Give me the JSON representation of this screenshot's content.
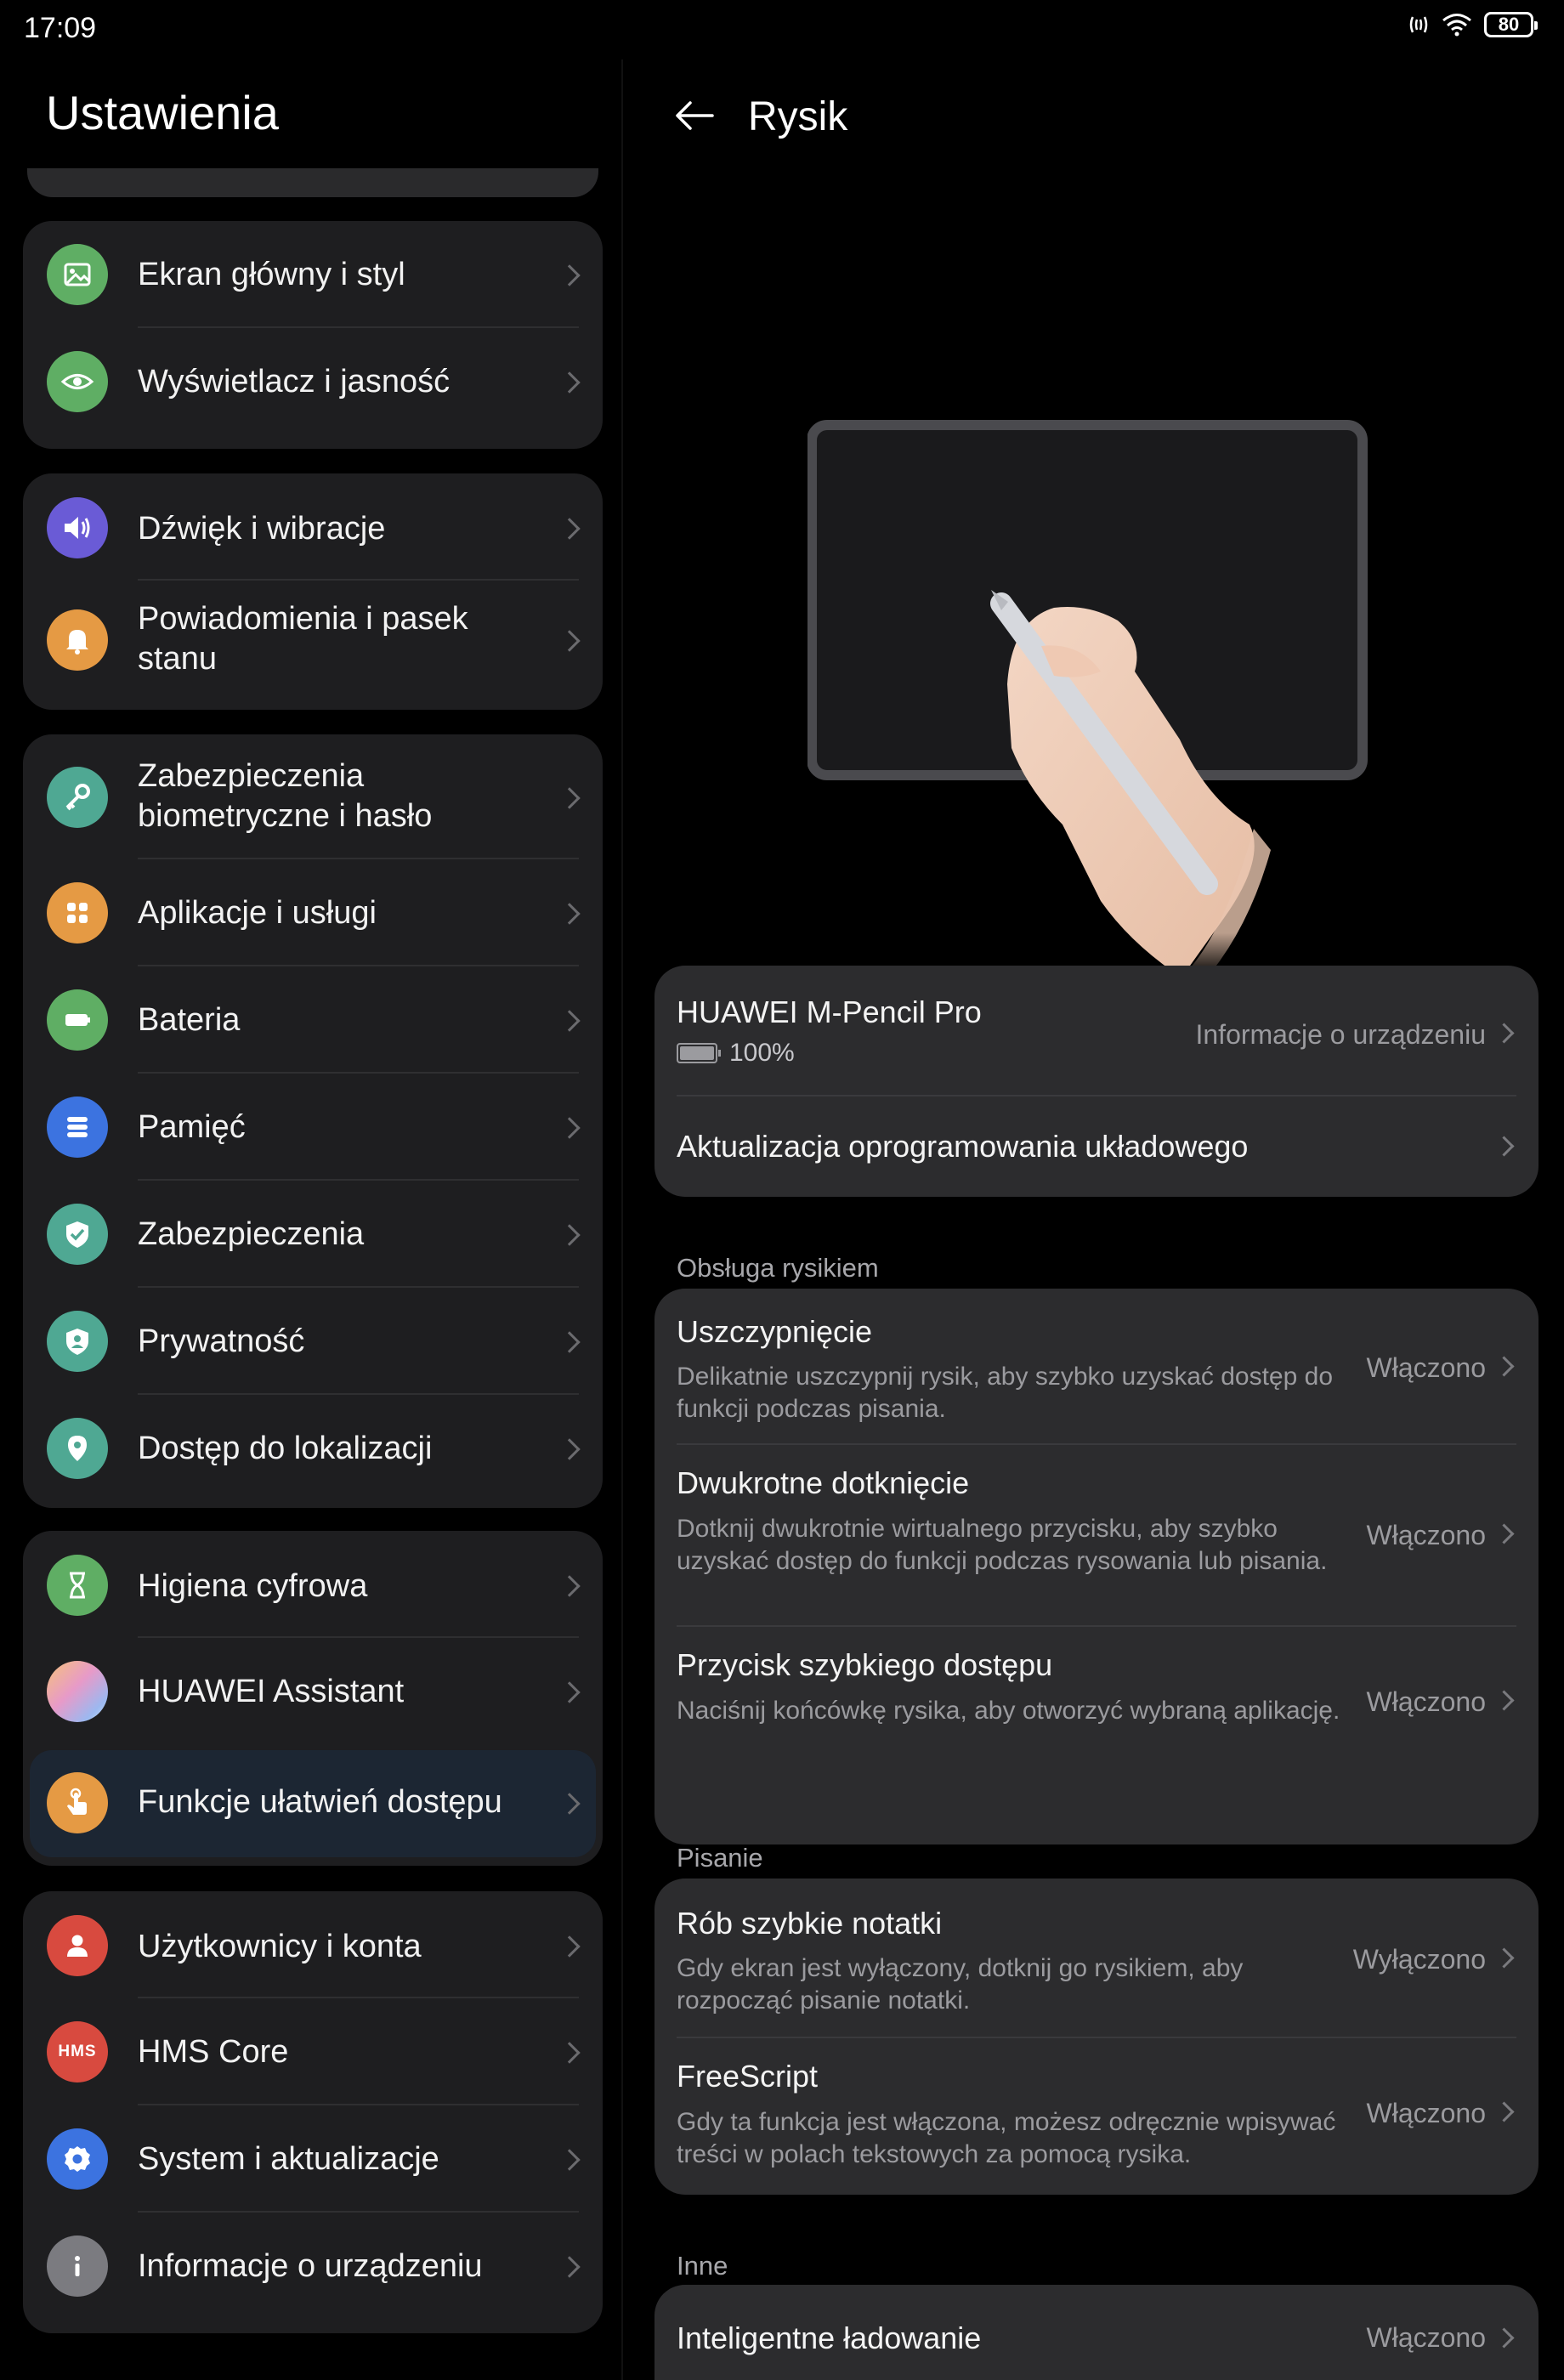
{
  "status_bar": {
    "time": "17:09",
    "battery": "80"
  },
  "left_pane": {
    "title": "Ustawienia",
    "groups": [
      {
        "items": [
          {
            "label": "Ekran główny i styl",
            "icon": "image-icon",
            "color": "#5fae64"
          },
          {
            "label": "Wyświetlacz i jasność",
            "icon": "eye-icon",
            "color": "#5fae64"
          }
        ]
      },
      {
        "items": [
          {
            "label": "Dźwięk i wibracje",
            "icon": "speaker-icon",
            "color": "#6a5bd6"
          },
          {
            "label": "Powiadomienia i pasek stanu",
            "icon": "bell-icon",
            "color": "#e59a44"
          }
        ]
      },
      {
        "items": [
          {
            "label": "Zabezpieczenia biometryczne i hasło",
            "icon": "key-icon",
            "color": "#4fa893"
          },
          {
            "label": "Aplikacje i usługi",
            "icon": "apps-icon",
            "color": "#e59a44"
          },
          {
            "label": "Bateria",
            "icon": "battery-icon",
            "color": "#5fae64"
          },
          {
            "label": "Pamięć",
            "icon": "storage-icon",
            "color": "#3c73e0"
          },
          {
            "label": "Zabezpieczenia",
            "icon": "shield-check-icon",
            "color": "#4fa893"
          },
          {
            "label": "Prywatność",
            "icon": "privacy-shield-icon",
            "color": "#4fa893"
          },
          {
            "label": "Dostęp do lokalizacji",
            "icon": "location-pin-icon",
            "color": "#4fa893"
          }
        ]
      },
      {
        "items": [
          {
            "label": "Higiena cyfrowa",
            "icon": "hourglass-icon",
            "color": "#5fae64"
          },
          {
            "label": "HUAWEI Assistant",
            "icon": "assistant-orb-icon",
            "color": "#c9a0e8"
          },
          {
            "label": "Funkcje ułatwień dostępu",
            "icon": "hand-touch-icon",
            "color": "#e59a44",
            "active": true
          }
        ]
      },
      {
        "items": [
          {
            "label": "Użytkownicy i konta",
            "icon": "user-icon",
            "color": "#d84a3f"
          },
          {
            "label": "HMS Core",
            "icon": "hms-icon",
            "color": "#d84a3f",
            "icon_text": "HMS"
          },
          {
            "label": "System i aktualizacje",
            "icon": "gear-icon",
            "color": "#3c73e0"
          },
          {
            "label": "Informacje o urządzeniu",
            "icon": "info-icon",
            "color": "#7b7b80"
          }
        ]
      }
    ]
  },
  "right_pane": {
    "title": "Rysik",
    "device": {
      "name": "HUAWEI M-Pencil Pro",
      "battery": "100%",
      "info_link": "Informacje o urządzeniu",
      "firmware": "Aktualizacja oprogramowania układowego"
    },
    "sections": [
      {
        "label": "Obsługa rysikiem",
        "rows": [
          {
            "title": "Uszczypnięcie",
            "desc": "Delikatnie uszczypnij rysik, aby szybko uzyskać dostęp do funkcji podczas pisania.",
            "value": "Włączono"
          },
          {
            "title": "Dwukrotne dotknięcie",
            "desc": "Dotknij dwukrotnie wirtualnego przycisku, aby szybko uzyskać dostęp do funkcji podczas rysowania lub pisania.",
            "value": "Włączono"
          },
          {
            "title": "Przycisk szybkiego dostępu",
            "desc": "Naciśnij końcówkę rysika, aby otworzyć wybraną aplikację.",
            "value": "Włączono"
          }
        ]
      },
      {
        "label": "Pisanie",
        "rows": [
          {
            "title": "Rób szybkie notatki",
            "desc": "Gdy ekran jest wyłączony, dotknij go rysikiem, aby rozpocząć pisanie notatki.",
            "value": "Wyłączono"
          },
          {
            "title": "FreeScript",
            "desc": "Gdy ta funkcja jest włączona, możesz odręcznie wpisywać treści w polach tekstowych za pomocą rysika.",
            "value": "Włączono"
          }
        ]
      },
      {
        "label": "Inne",
        "rows": [
          {
            "title": "Inteligentne ładowanie",
            "value": "Włączono"
          }
        ]
      }
    ]
  }
}
